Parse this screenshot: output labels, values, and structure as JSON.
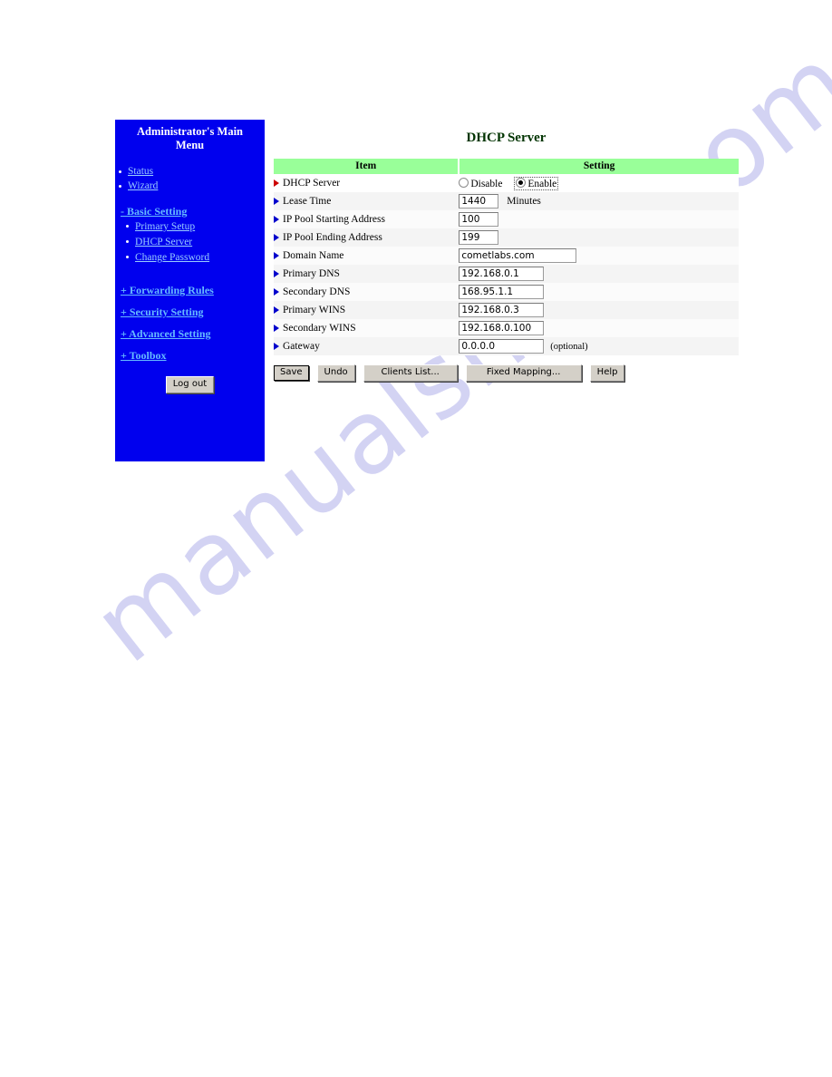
{
  "watermark": {
    "text": "manualshive.com"
  },
  "sidebar": {
    "title": "Administrator's Main Menu",
    "bg_color": "#0000ee",
    "link_color": "#99ccff",
    "top_items": [
      {
        "label": "Status"
      },
      {
        "label": "Wizard"
      }
    ],
    "groups": [
      {
        "label": "- Basic Setting",
        "children": [
          {
            "label": "Primary Setup"
          },
          {
            "label": "DHCP Server"
          },
          {
            "label": "Change Password"
          }
        ]
      },
      {
        "label": "+ Forwarding Rules",
        "children": []
      },
      {
        "label": "+ Security Setting",
        "children": []
      },
      {
        "label": "+ Advanced Setting",
        "children": []
      },
      {
        "label": "+ Toolbox",
        "children": []
      }
    ],
    "logout_label": "Log out"
  },
  "main": {
    "title": "DHCP Server",
    "title_color": "#003300",
    "table": {
      "header_bg": "#99ff99",
      "headers": [
        "Item",
        "Setting"
      ],
      "rows": [
        {
          "label": "DHCP Server",
          "marker": "red-arrow-icon",
          "type": "radio",
          "options": [
            {
              "label": "Disable",
              "checked": false,
              "focused": false
            },
            {
              "label": "Enable",
              "checked": true,
              "focused": true
            }
          ],
          "value": "",
          "suffix": ""
        },
        {
          "label": "Lease Time",
          "marker": "blue-arrow-icon",
          "type": "text-small",
          "value": "1440",
          "suffix": "Minutes"
        },
        {
          "label": "IP Pool Starting Address",
          "marker": "blue-arrow-icon",
          "type": "text-small",
          "value": "100",
          "suffix": ""
        },
        {
          "label": "IP Pool Ending Address",
          "marker": "blue-arrow-icon",
          "type": "text-small",
          "value": "199",
          "suffix": ""
        },
        {
          "label": "Domain Name",
          "marker": "blue-arrow-icon",
          "type": "text-medium",
          "value": "cometlabs.com",
          "suffix": ""
        },
        {
          "label": "Primary DNS",
          "marker": "blue-arrow-icon",
          "type": "text-ip",
          "value": "192.168.0.1",
          "suffix": ""
        },
        {
          "label": "Secondary DNS",
          "marker": "blue-arrow-icon",
          "type": "text-ip",
          "value": "168.95.1.1",
          "suffix": ""
        },
        {
          "label": "Primary WINS",
          "marker": "blue-arrow-icon",
          "type": "text-ip",
          "value": "192.168.0.3",
          "suffix": ""
        },
        {
          "label": "Secondary WINS",
          "marker": "blue-arrow-icon",
          "type": "text-ip",
          "value": "192.168.0.100",
          "suffix": ""
        },
        {
          "label": "Gateway",
          "marker": "blue-arrow-icon",
          "type": "text-ip",
          "value": "0.0.0.0",
          "suffix": "(optional)"
        }
      ]
    },
    "buttons": [
      {
        "label": "Save",
        "default": true
      },
      {
        "label": "Undo",
        "default": false
      },
      {
        "label": "Clients List...",
        "default": false
      },
      {
        "label": "Fixed Mapping...",
        "default": false
      },
      {
        "label": "Help",
        "default": false
      }
    ]
  }
}
